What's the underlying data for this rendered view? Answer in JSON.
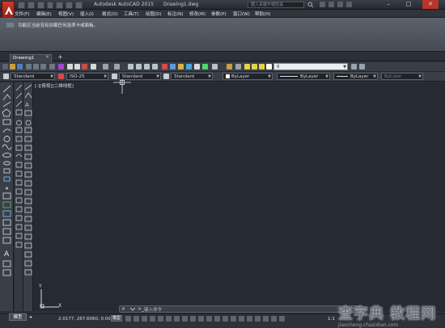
{
  "app": {
    "title_prefix": "Autodesk AutoCAD 2015",
    "document": "Drawing1.dwg",
    "search_placeholder": "键入关键字或短语"
  },
  "menu": {
    "items": [
      "文件(F)",
      "编辑(E)",
      "视图(V)",
      "插入(I)",
      "格式(O)",
      "工具(T)",
      "绘图(D)",
      "标注(N)",
      "修改(M)",
      "参数(P)",
      "窗口(W)",
      "帮助(H)"
    ]
  },
  "ribbon": {
    "message": "功能区当前没有加载任何选项卡或面板。"
  },
  "tabs": {
    "active": "Drawing1",
    "close": "×",
    "add": "+"
  },
  "toolbar": {
    "layer_value": "0"
  },
  "styles": {
    "text_style": "Standard",
    "dim_style": "ISO-25",
    "table_style": "Standard",
    "mleader_style": "Standard",
    "color": "ByLayer",
    "linetype": "ByLayer",
    "lineweight": "ByLayer",
    "plotstyle": "ByColor"
  },
  "viewport": {
    "label": "[-][俯视][二维线框]"
  },
  "command": {
    "prompt": "键入命令",
    "close": "×"
  },
  "status": {
    "model_tab": "模型",
    "coords": "2.0177, 267.6060, 0.0000",
    "model_button": "模型",
    "scale": "1:1"
  },
  "watermark": {
    "main": "查字典 教程网",
    "sub": "jiaocheng.chazidian.com"
  },
  "ucs": {
    "x": "X",
    "y": "Y"
  },
  "colors": {
    "canvas": "#262b33",
    "accent": "#d23a2a"
  }
}
